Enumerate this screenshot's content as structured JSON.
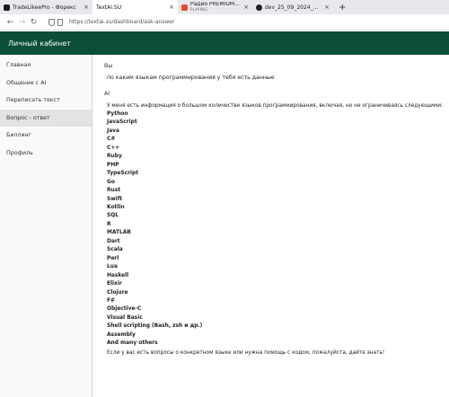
{
  "browser": {
    "tabs": [
      {
        "title": "TradeLikeePro - Форекс",
        "favicon_color": "#1a1a1a",
        "active": false
      },
      {
        "title": "TextAI.SU",
        "favicon_color": "",
        "active": true
      },
      {
        "title": "Радио PREMIUM | ПРЕМ",
        "subtitle": "PLAYING",
        "favicon_color": "#e34b2a",
        "active": false
      },
      {
        "title": "dev_25_09_2024_2 by Gi",
        "favicon_color": "#222222",
        "active": false
      }
    ],
    "close_glyph": "×",
    "new_tab_glyph": "+",
    "url": "https://textai.su/dashboard/ask-answer",
    "back_glyph": "←",
    "forward_glyph": "→",
    "reload_glyph": "↻"
  },
  "header": {
    "title": "Личный кабинет"
  },
  "sidebar": {
    "items": [
      {
        "label": "Главная"
      },
      {
        "label": "Общение с AI"
      },
      {
        "label": "Переписать текст"
      },
      {
        "label": "Вопрос - ответ"
      },
      {
        "label": "Биллинг"
      },
      {
        "label": "Профиль"
      }
    ],
    "active_index": 3
  },
  "chat": {
    "user_label": "Вы",
    "user_message": "по каким языкам программирования у тебя есть данные",
    "ai_label": "AI",
    "ai_intro": "У меня есть информация о большом количестве языков программирования, включая, но не ограничиваясь следующими:",
    "languages": [
      "Python",
      "JavaScript",
      "Java",
      "C#",
      "C++",
      "Ruby",
      "PHP",
      "TypeScript",
      "Go",
      "Rust",
      "Swift",
      "Kotlin",
      "SQL",
      "R",
      "MATLAB",
      "Dart",
      "Scala",
      "Perl",
      "Lua",
      "Haskell",
      "Elixir",
      "Clojure",
      "F#",
      "Objective-C",
      "Visual Basic",
      "Shell scripting (Bash, zsh и др.)",
      "Assembly",
      "And many others"
    ],
    "ai_outro": "Если у вас есть вопросы о конкретном языке или нужна помощь с кодом, пожалуйста, дайте знать!"
  }
}
